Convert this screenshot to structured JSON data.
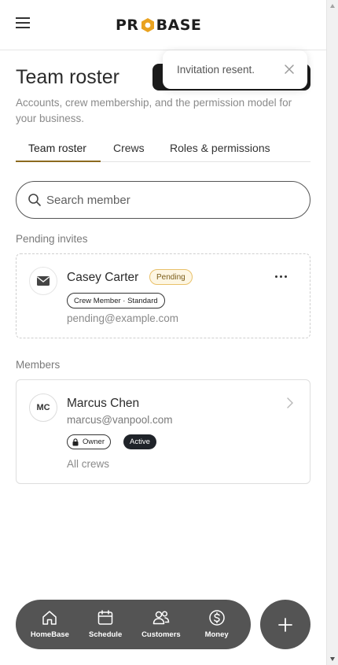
{
  "header": {
    "logo": {
      "left": "PR",
      "right": "BASE",
      "accent_color": "#e9a21f"
    }
  },
  "page": {
    "title": "Team roster",
    "subtitle": "Accounts, crew membership, and the permission model for your business."
  },
  "toast": {
    "message": "Invitation resent."
  },
  "tabs": [
    {
      "label": "Team roster",
      "active": true
    },
    {
      "label": "Crews",
      "active": false
    },
    {
      "label": "Roles & permissions",
      "active": false
    }
  ],
  "search": {
    "placeholder": "Search member",
    "value": ""
  },
  "pending": {
    "section_label": "Pending invites",
    "invites": [
      {
        "name": "Casey Carter",
        "status": "Pending",
        "role": "Crew Member · Standard",
        "email": "pending@example.com",
        "icon": "mail-icon"
      }
    ]
  },
  "members": {
    "section_label": "Members",
    "list": [
      {
        "initials": "MC",
        "name": "Marcus Chen",
        "email": "marcus@vanpool.com",
        "role": "Owner",
        "status": "Active",
        "crews": "All crews"
      }
    ]
  },
  "bottom_nav": [
    {
      "label": "HomeBase",
      "icon": "home-icon"
    },
    {
      "label": "Schedule",
      "icon": "calendar-icon"
    },
    {
      "label": "Customers",
      "icon": "users-icon"
    },
    {
      "label": "Money",
      "icon": "dollar-icon"
    }
  ],
  "colors": {
    "accent": "#8c6a1f",
    "nav_bg": "#545454",
    "pending_border": "#e9c16a",
    "active_badge": "#1f2329"
  }
}
